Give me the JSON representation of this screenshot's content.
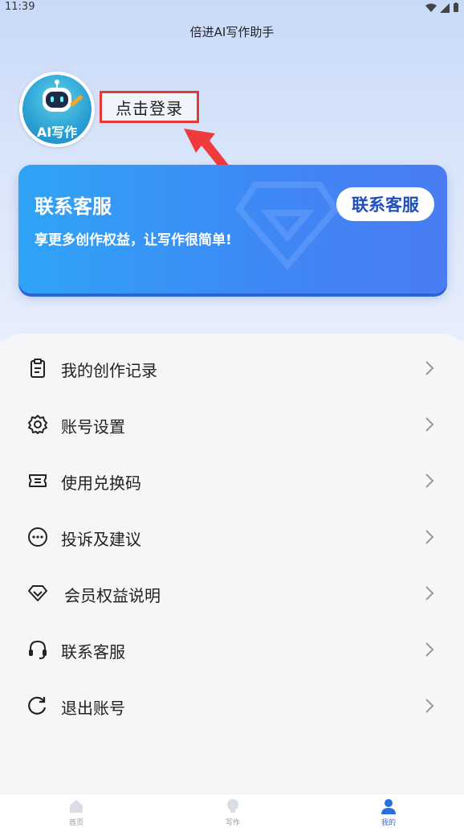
{
  "status_bar": {
    "time": "11:39"
  },
  "header": {
    "title": "倍进AI写作助手"
  },
  "profile": {
    "avatar_text": "AI写作",
    "login_label": "点击登录"
  },
  "banner": {
    "title": "联系客服",
    "subtitle": "享更多创作权益，让写作很简单!",
    "button_label": "联系客服"
  },
  "menu": {
    "items": [
      {
        "label": "我的创作记录",
        "icon": "clipboard-icon"
      },
      {
        "label": "账号设置",
        "icon": "gear-icon"
      },
      {
        "label": "使用兑换码",
        "icon": "ticket-icon"
      },
      {
        "label": "投诉及建议",
        "icon": "chat-dots-icon"
      },
      {
        "label": "会员权益说明",
        "icon": "diamond-icon"
      },
      {
        "label": "联系客服",
        "icon": "headset-icon"
      },
      {
        "label": "退出账号",
        "icon": "refresh-icon"
      }
    ]
  },
  "tabbar": {
    "tabs": [
      {
        "label": "首页",
        "icon": "home-icon"
      },
      {
        "label": "写作",
        "icon": "bulb-icon"
      },
      {
        "label": "我的",
        "icon": "user-icon",
        "active": true
      }
    ]
  },
  "colors": {
    "accent": "#2a6fe0",
    "highlight": "#e53935"
  }
}
